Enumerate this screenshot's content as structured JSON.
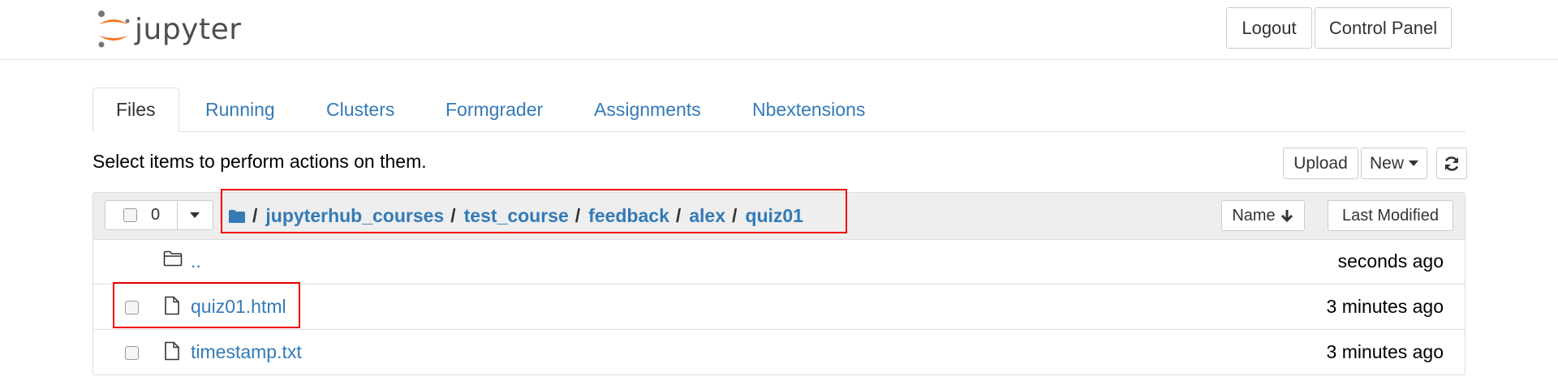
{
  "header": {
    "logo_text": "jupyter",
    "logout_label": "Logout",
    "control_panel_label": "Control Panel"
  },
  "tabs": [
    {
      "label": "Files",
      "active": true
    },
    {
      "label": "Running"
    },
    {
      "label": "Clusters"
    },
    {
      "label": "Formgrader"
    },
    {
      "label": "Assignments"
    },
    {
      "label": "Nbextensions"
    }
  ],
  "toolbar": {
    "instructions": "Select items to perform actions on them.",
    "upload_label": "Upload",
    "new_label": "New"
  },
  "list_header": {
    "selected_count": "0",
    "breadcrumb": [
      {
        "label": "jupyterhub_courses"
      },
      {
        "label": "test_course"
      },
      {
        "label": "feedback"
      },
      {
        "label": "alex"
      },
      {
        "label": "quiz01"
      }
    ],
    "separator": "/",
    "sort_name_label": "Name",
    "sort_last_modified_label": "Last Modified"
  },
  "rows": [
    {
      "name": "..",
      "modified": "seconds ago",
      "type": "folder"
    },
    {
      "name": "quiz01.html",
      "modified": "3 minutes ago",
      "type": "file"
    },
    {
      "name": "timestamp.txt",
      "modified": "3 minutes ago",
      "type": "file"
    }
  ],
  "colors": {
    "link": "#337ab7",
    "logo_orange": "#f37726",
    "highlight": "#e00000"
  }
}
